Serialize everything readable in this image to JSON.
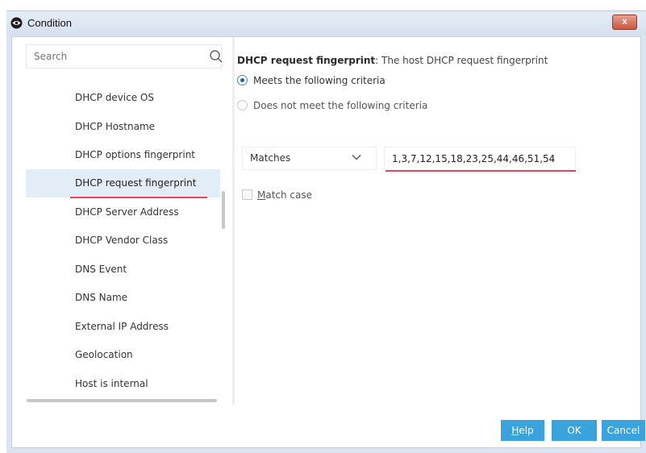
{
  "window": {
    "title": "Condition",
    "close_label": "x"
  },
  "sidebar": {
    "search_placeholder": "Search",
    "items": [
      {
        "label": "DHCP device OS"
      },
      {
        "label": "DHCP Hostname"
      },
      {
        "label": "DHCP options fingerprint"
      },
      {
        "label": "DHCP request fingerprint",
        "selected": true
      },
      {
        "label": "DHCP Server Address"
      },
      {
        "label": "DHCP Vendor Class"
      },
      {
        "label": "DNS Event"
      },
      {
        "label": "DNS Name"
      },
      {
        "label": "External IP Address"
      },
      {
        "label": "Geolocation"
      },
      {
        "label": "Host is internal"
      }
    ]
  },
  "panel": {
    "title": "DHCP request fingerprint",
    "description": ": The host DHCP request fingerprint",
    "radio_meets": "Meets the following criteria",
    "radio_not_meets": "Does not meet the following criteria",
    "operator": "Matches",
    "value": "1,3,7,12,15,18,23,25,44,46,51,54",
    "match_case_first": "M",
    "match_case_rest": "atch case"
  },
  "buttons": {
    "help_first": "H",
    "help_rest": "elp",
    "ok": "OK",
    "cancel": "Cancel"
  },
  "colors": {
    "accent": "#3aa2dc",
    "highlight_underline": "#e6455d",
    "selected_row": "#e3edf8"
  }
}
